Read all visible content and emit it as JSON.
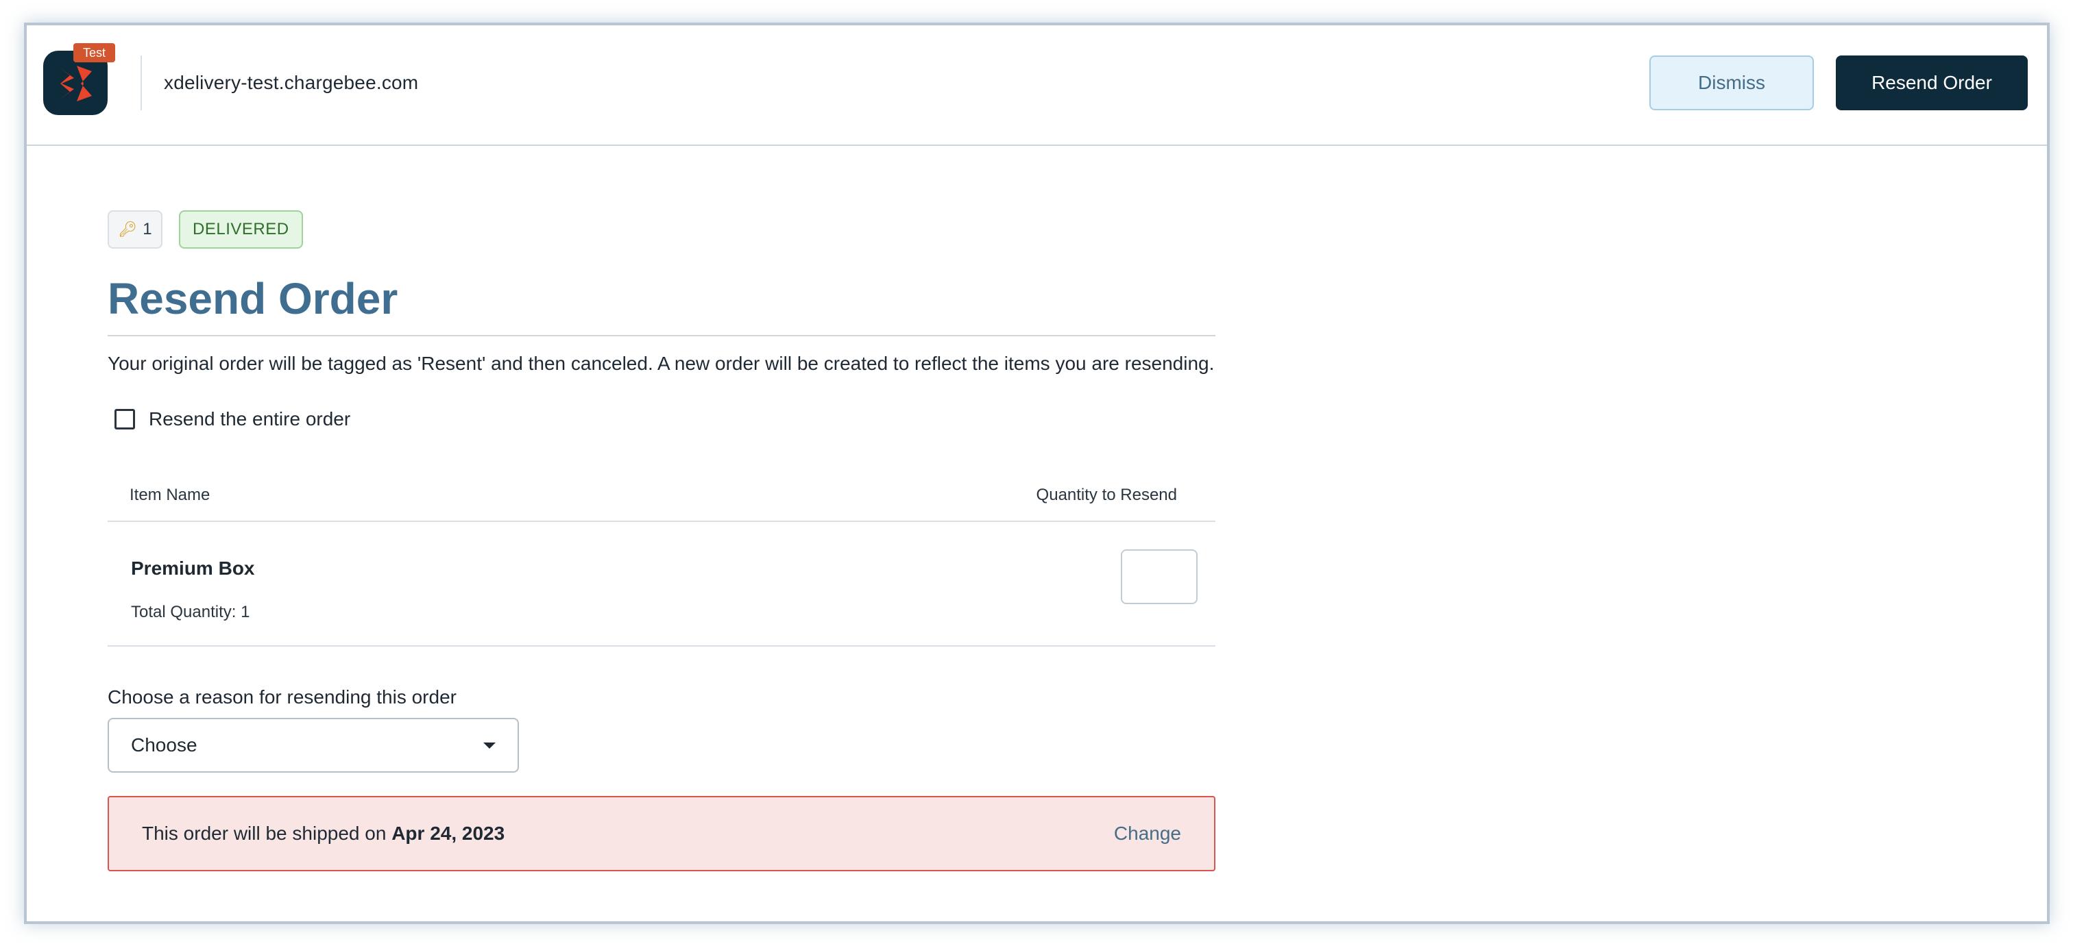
{
  "header": {
    "badge": "Test",
    "domain": "xdelivery-test.chargebee.com",
    "dismiss_label": "Dismiss",
    "resend_label": "Resend Order"
  },
  "status": {
    "key_count": "1",
    "key_icon": "key-icon",
    "badge": "DELIVERED"
  },
  "page": {
    "title": "Resend Order",
    "description": "Your original order will be tagged as 'Resent' and then canceled. A new order will be created to reflect the items you are resending."
  },
  "resend_entire": {
    "label": "Resend the entire order",
    "checked": false
  },
  "table": {
    "columns": [
      "Item Name",
      "Quantity to Resend"
    ],
    "rows": [
      {
        "name": "Premium Box",
        "total_quantity": "Total Quantity: 1",
        "quantity_value": ""
      }
    ]
  },
  "reason": {
    "label": "Choose a reason for resending this order",
    "selected": "Choose"
  },
  "shipping": {
    "prefix": "This order will be shipped on",
    "date": "Apr 24, 2023",
    "change_label": "Change"
  },
  "colors": {
    "primary_dark": "#0e2b3c",
    "title_blue": "#3f6e90",
    "badge_orange": "#d2552d",
    "delivered_green": "#2f6e2c",
    "alert_red": "#d9564f"
  }
}
